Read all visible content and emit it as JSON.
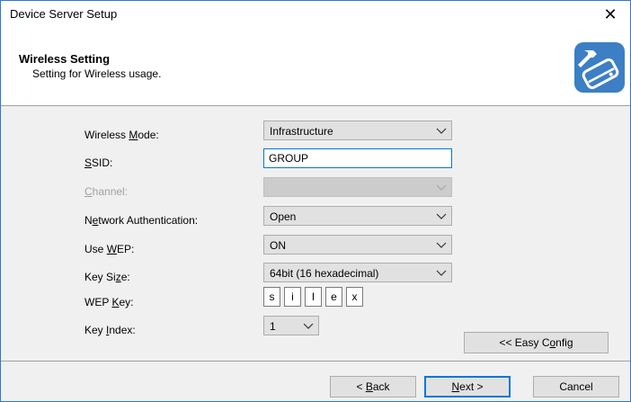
{
  "window": {
    "title": "Device Server Setup",
    "close_glyph": "✕"
  },
  "header": {
    "title": "Wireless Setting",
    "subtitle": "Setting for Wireless usage.",
    "icon": "wrench-router-icon"
  },
  "fields": {
    "wireless_mode": {
      "label_pre": "Wireless ",
      "label_u": "M",
      "label_post": "ode:",
      "value": "Infrastructure"
    },
    "ssid": {
      "label_pre": "",
      "label_u": "S",
      "label_post": "SID:",
      "value": "GROUP"
    },
    "channel": {
      "label_pre": "",
      "label_u": "C",
      "label_post": "hannel:",
      "value": ""
    },
    "network_auth": {
      "label_pre": "N",
      "label_u": "e",
      "label_post": "twork Authentication:",
      "value": "Open"
    },
    "use_wep": {
      "label_pre": "Use ",
      "label_u": "W",
      "label_post": "EP:",
      "value": "ON"
    },
    "key_size": {
      "label_pre": "Key Si",
      "label_u": "z",
      "label_post": "e:",
      "value": "64bit (16 hexadecimal)"
    },
    "wep_key": {
      "label_pre": "WEP ",
      "label_u": "K",
      "label_post": "ey:",
      "chars": [
        "s",
        "i",
        "l",
        "e",
        "x"
      ]
    },
    "key_index": {
      "label_pre": "Key ",
      "label_u": "I",
      "label_post": "ndex:",
      "value": "1"
    }
  },
  "buttons": {
    "easy_config": {
      "pre": "<< Easy C",
      "u": "o",
      "post": "nfig"
    },
    "back": {
      "pre": "< ",
      "u": "B",
      "post": "ack"
    },
    "next": {
      "pre": "",
      "u": "N",
      "post": "ext >"
    },
    "cancel": {
      "label": "Cancel"
    }
  }
}
